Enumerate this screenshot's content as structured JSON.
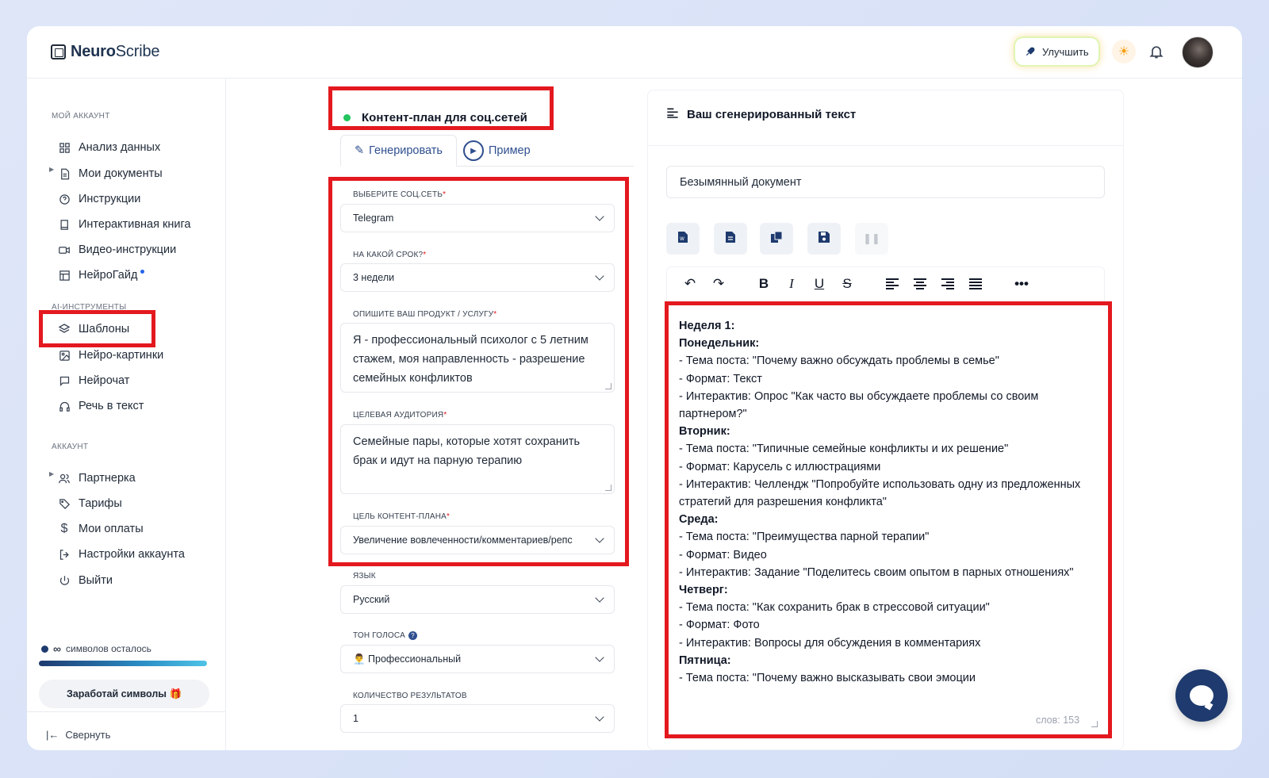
{
  "header": {
    "logo_bold": "Neuro",
    "logo_light": "Scribe",
    "upgrade_label": "Улучшить"
  },
  "sidebar": {
    "section_account": "МОЙ АККАУНТ",
    "section_ai": "AI-ИНСТРУМЕНТЫ",
    "section_acc2": "АККАУНТ",
    "items": [
      {
        "label": "Анализ данных",
        "icon": "grid-icon"
      },
      {
        "label": "Мои документы",
        "icon": "document-icon"
      },
      {
        "label": "Инструкции",
        "icon": "help-circle-icon"
      },
      {
        "label": "Интерактивная книга",
        "icon": "book-icon"
      },
      {
        "label": "Видео-инструкции",
        "icon": "video-icon"
      },
      {
        "label": "НейроГайд",
        "icon": "layout-icon"
      },
      {
        "label": "Шаблоны",
        "icon": "layers-icon"
      },
      {
        "label": "Нейро-картинки",
        "icon": "image-icon"
      },
      {
        "label": "Нейрочат",
        "icon": "chat-icon"
      },
      {
        "label": "Речь в текст",
        "icon": "headphones-icon"
      },
      {
        "label": "Партнерка",
        "icon": "users-icon"
      },
      {
        "label": "Тарифы",
        "icon": "tag-icon"
      },
      {
        "label": "Мои оплаты",
        "icon": "dollar-icon"
      },
      {
        "label": "Настройки аккаунта",
        "icon": "logout-arrow-icon"
      },
      {
        "label": "Выйти",
        "icon": "power-icon"
      }
    ],
    "credits_text": "символов осталось",
    "earn_label": "Заработай символы 🎁",
    "collapse_label": "Свернуть"
  },
  "form": {
    "title": "Контент-план для соц.сетей",
    "tab_generate": "Генерировать",
    "tab_example": "Пример",
    "fields": {
      "social_label": "ВЫБЕРИТЕ СОЦ.СЕТЬ",
      "social_value": "Telegram",
      "period_label": "НА КАКОЙ СРОК?",
      "period_value": "3 недели",
      "product_label": "ОПИШИТЕ ВАШ ПРОДУКТ / УСЛУГУ",
      "product_value": "Я - профессиональный психолог с 5 летним стажем, моя направленность - разрешение семейных конфликтов",
      "audience_label": "ЦЕЛЕВАЯ АУДИТОРИЯ",
      "audience_value": "Семейные пары, которые хотят сохранить брак и идут на парную терапию",
      "goal_label": "ЦЕЛЬ КОНТЕНТ-ПЛАНА",
      "goal_value": "Увеличение вовлеченности/комментариев/репс",
      "lang_label": "ЯЗЫК",
      "lang_value": "Русский",
      "tone_label": "ТОН ГОЛОСА",
      "tone_value": "👨‍💼 Профессиональный",
      "count_label": "КОЛИЧЕСТВО РЕЗУЛЬТАТОВ",
      "count_value": "1"
    }
  },
  "output": {
    "title": "Ваш сгенерированный текст",
    "doc_name": "Безымянный документ",
    "lines": [
      {
        "t": "Неделя 1:",
        "b": true
      },
      {
        "t": "Понедельник:",
        "b": true
      },
      {
        "t": "- Тема поста: \"Почему важно обсуждать проблемы в семье\"",
        "b": false
      },
      {
        "t": "- Формат: Текст",
        "b": false
      },
      {
        "t": "- Интерактив: Опрос \"Как часто вы обсуждаете проблемы со своим партнером?\"",
        "b": false
      },
      {
        "t": "Вторник:",
        "b": true
      },
      {
        "t": "- Тема поста: \"Типичные семейные конфликты и их решение\"",
        "b": false
      },
      {
        "t": "- Формат: Карусель с иллюстрациями",
        "b": false
      },
      {
        "t": "- Интерактив: Челлендж \"Попробуйте использовать одну из предложенных стратегий для разрешения конфликта\"",
        "b": false
      },
      {
        "t": "Среда:",
        "b": true
      },
      {
        "t": "- Тема поста: \"Преимущества парной терапии\"",
        "b": false
      },
      {
        "t": "- Формат: Видео",
        "b": false
      },
      {
        "t": "- Интерактив: Задание \"Поделитесь своим опытом в парных отношениях\"",
        "b": false
      },
      {
        "t": "Четверг:",
        "b": true
      },
      {
        "t": "- Тема поста: \"Как сохранить брак в стрессовой ситуации\"",
        "b": false
      },
      {
        "t": "- Формат: Фото",
        "b": false
      },
      {
        "t": "- Интерактив: Вопросы для обсуждения в комментариях",
        "b": false
      },
      {
        "t": "Пятница:",
        "b": true
      },
      {
        "t": "- Тема поста: \"Почему важно высказывать свои эмоции",
        "b": false
      }
    ],
    "word_count": "слов: 153"
  },
  "colors": {
    "accent": "#2f4f8f",
    "highlight": "#e3191f",
    "brand_dark": "#1e3a6e"
  }
}
